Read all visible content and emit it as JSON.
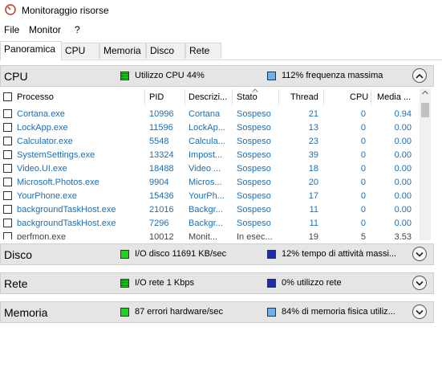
{
  "window": {
    "title": "Monitoraggio risorse"
  },
  "menu": [
    "File",
    "Monitor",
    "?"
  ],
  "tabs": [
    "Panoramica",
    "CPU",
    "Memoria",
    "Disco",
    "Rete"
  ],
  "colors": {
    "green": "#1fd21f",
    "blue": "#1c2ea8",
    "lightblue": "#6fb1e6",
    "link": "#1a6fb6"
  },
  "cpu": {
    "title": "CPU",
    "stat1": "Utilizzo CPU 44%",
    "stat2": "112% frequenza massima",
    "columns": [
      "Processo",
      "PID",
      "Descrizi...",
      "Stato",
      "Thread",
      "CPU",
      "Media ..."
    ],
    "rows": [
      [
        "Cortana.exe",
        "10996",
        "Cortana",
        "Sospeso",
        "21",
        "0",
        "0.94"
      ],
      [
        "LockApp.exe",
        "11596",
        "LockAp...",
        "Sospeso",
        "13",
        "0",
        "0.00"
      ],
      [
        "Calculator.exe",
        "5548",
        "Calcula...",
        "Sospeso",
        "23",
        "0",
        "0.00"
      ],
      [
        "SystemSettings.exe",
        "13324",
        "Impost...",
        "Sospeso",
        "39",
        "0",
        "0.00"
      ],
      [
        "Video.UI.exe",
        "18488",
        "Video ...",
        "Sospeso",
        "18",
        "0",
        "0.00"
      ],
      [
        "Microsoft.Photos.exe",
        "9904",
        "Micros...",
        "Sospeso",
        "20",
        "0",
        "0.00"
      ],
      [
        "YourPhone.exe",
        "15436",
        "YourPh...",
        "Sospeso",
        "17",
        "0",
        "0.00"
      ],
      [
        "backgroundTaskHost.exe",
        "21016",
        "Backgr...",
        "Sospeso",
        "11",
        "0",
        "0.00"
      ],
      [
        "backgroundTaskHost.exe",
        "7296",
        "Backgr...",
        "Sospeso",
        "11",
        "0",
        "0.00"
      ],
      [
        "perfmon.exe",
        "10012",
        "Monit...",
        "In esec...",
        "19",
        "5",
        "3.53"
      ]
    ]
  },
  "disco": {
    "title": "Disco",
    "stat1": "I/O disco 11691 KB/sec",
    "stat2": "12% tempo di attività massi..."
  },
  "rete": {
    "title": "Rete",
    "stat1": "I/O rete 1 Kbps",
    "stat2": "0% utilizzo rete"
  },
  "memoria": {
    "title": "Memoria",
    "stat1": "87 errori hardware/sec",
    "stat2": "84% di memoria fisica utiliz..."
  }
}
